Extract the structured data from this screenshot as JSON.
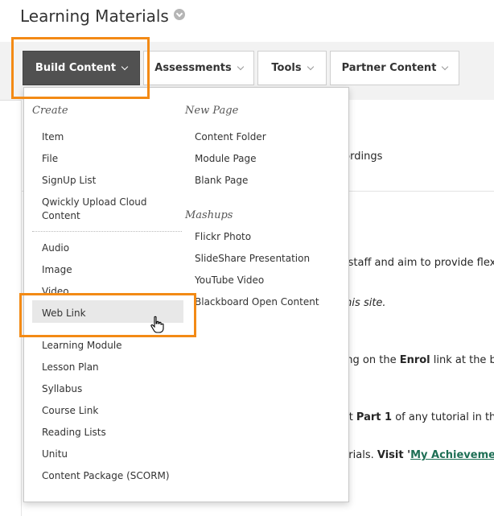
{
  "page": {
    "title": "Learning Materials"
  },
  "toolbar": {
    "build_content": "Build Content",
    "assessments": "Assessments",
    "tools": "Tools",
    "partner_content": "Partner Content"
  },
  "background": {
    "recordings": "ecordings",
    "flex_line": "ng staff and aim to provide flex",
    "site_line": "o this site.",
    "enrol_pre": "cking on the ",
    "enrol_bold": "Enrol",
    "enrol_post": " link at the b",
    "visit_pre": "visit ",
    "visit_bold": "Part 1",
    "visit_post": " of any tutorial in the",
    "tut_pre": "utorials. ",
    "tut_bold": "Visit '",
    "tut_link": "My Achievemen"
  },
  "menu": {
    "create_heading": "Create",
    "create_items": [
      "Item",
      "File",
      "SignUp List",
      "Qwickly Upload Cloud",
      "Content"
    ],
    "media_items": [
      "Audio",
      "Image",
      "Video",
      "Web Link"
    ],
    "more_items": [
      "Learning Module",
      "Lesson Plan",
      "Syllabus",
      "Course Link",
      "Reading Lists",
      "Unitu",
      "Content Package (SCORM)"
    ],
    "new_page_heading": "New Page",
    "new_page_items": [
      "Content Folder",
      "Module Page",
      "Blank Page"
    ],
    "mashups_heading": "Mashups",
    "mashups_items": [
      "Flickr Photo",
      "SlideShare Presentation",
      "YouTube Video",
      "Blackboard Open Content"
    ]
  },
  "colors": {
    "highlight": "#f38a15",
    "primary_button": "#515151",
    "link": "#1e6f55"
  }
}
